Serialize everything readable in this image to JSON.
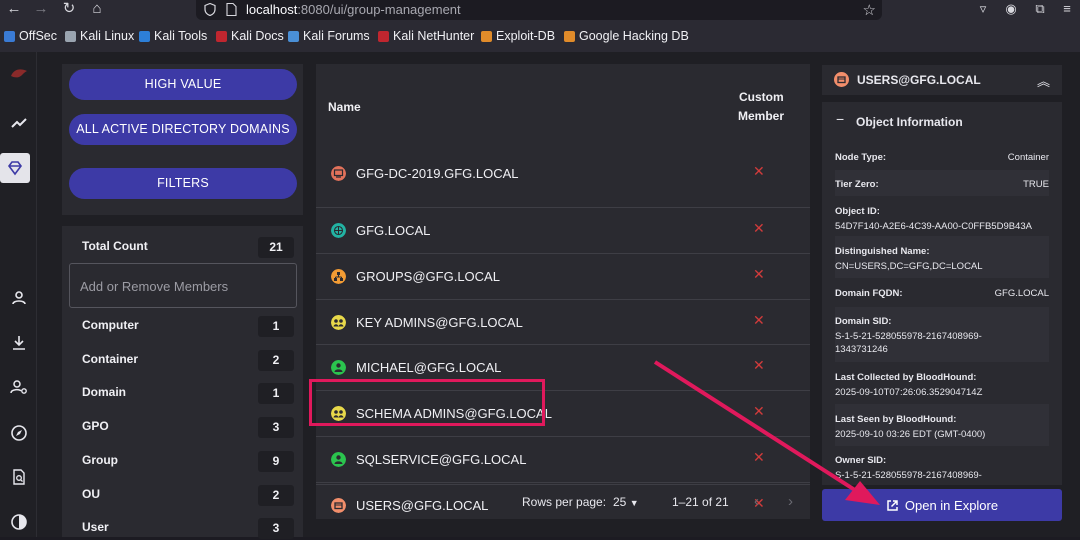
{
  "browser": {
    "url_host": "localhost",
    "url_path": ":8080/ui/group-management",
    "bookmarks": [
      {
        "label": "OffSec",
        "color": "#3a7bd5"
      },
      {
        "label": "Kali Linux",
        "color": "#9aa4b0"
      },
      {
        "label": "Kali Tools",
        "color": "#2d7fd8"
      },
      {
        "label": "Kali Docs",
        "color": "#c0262f"
      },
      {
        "label": "Kali Forums",
        "color": "#4a8fd6"
      },
      {
        "label": "Kali NetHunter",
        "color": "#c0262f"
      },
      {
        "label": "Exploit-DB",
        "color": "#e08b2a"
      },
      {
        "label": "Google Hacking DB",
        "color": "#e08b2a"
      }
    ]
  },
  "filters": {
    "high_value": "HIGH VALUE",
    "all_domains": "ALL ACTIVE DIRECTORY DOMAINS",
    "filters": "FILTERS"
  },
  "counts": {
    "total_label": "Total Count",
    "total": "21",
    "search_placeholder": "Add or Remove Members",
    "items": [
      {
        "label": "Computer",
        "count": "1"
      },
      {
        "label": "Container",
        "count": "2"
      },
      {
        "label": "Domain",
        "count": "1"
      },
      {
        "label": "GPO",
        "count": "3"
      },
      {
        "label": "Group",
        "count": "9"
      },
      {
        "label": "OU",
        "count": "2"
      },
      {
        "label": "User",
        "count": "3"
      }
    ]
  },
  "table": {
    "col_name": "Name",
    "col_custom_1": "Custom",
    "col_custom_2": "Member",
    "rows": [
      {
        "name": "GFG-DC-2019.GFG.LOCAL",
        "icon": "computer-icon",
        "color": "#e2725b"
      },
      {
        "name": "GFG.LOCAL",
        "icon": "globe-icon",
        "color": "#22b3a3"
      },
      {
        "name": "GROUPS@GFG.LOCAL",
        "icon": "tree-icon",
        "color": "#f39c34"
      },
      {
        "name": "KEY ADMINS@GFG.LOCAL",
        "icon": "group-icon",
        "color": "#e8d94a"
      },
      {
        "name": "MICHAEL@GFG.LOCAL",
        "icon": "user-icon",
        "color": "#2bc44e"
      },
      {
        "name": "SCHEMA ADMINS@GFG.LOCAL",
        "icon": "group-icon",
        "color": "#e8d94a"
      },
      {
        "name": "SQLSERVICE@GFG.LOCAL",
        "icon": "user-icon",
        "color": "#2bc44e"
      },
      {
        "name": "USERS@GFG.LOCAL",
        "icon": "box-icon",
        "color": "#f28e6b"
      }
    ],
    "remove_mark": "✕",
    "rows_per_page_label": "Rows per page:",
    "rows_per_page": "25",
    "range": "1–21 of 21"
  },
  "object": {
    "title": "USERS@GFG.LOCAL",
    "section": "Object Information",
    "node_type_k": "Node Type:",
    "node_type_v": "Container",
    "tier_zero_k": "Tier Zero:",
    "tier_zero_v": "TRUE",
    "object_id_k": "Object ID:",
    "object_id_v": "54D7F140-A2E6-4C39-AA00-C0FFB5D9B43A",
    "dn_k": "Distinguished Name:",
    "dn_v": "CN=USERS,DC=GFG,DC=LOCAL",
    "fqdn_k": "Domain FQDN:",
    "fqdn_v": "GFG.LOCAL",
    "sid_k": "Domain SID:",
    "sid_v1": "S-1-5-21-528055978-2167408969-",
    "sid_v2": "1343731246",
    "collected_k": "Last Collected by BloodHound:",
    "collected_v": "2025-09-10T07:26:06.352904714Z",
    "seen_k": "Last Seen by BloodHound:",
    "seen_v": "2025-09-10 03:26 EDT (GMT-0400)",
    "owner_k": "Owner SID:",
    "owner_v": "S-1-5-21-528055978-2167408969-",
    "open_btn": "Open in Explore"
  },
  "colors": {
    "accent": "#3d3aa6",
    "highlight": "#e0195c",
    "remove": "#d23b3b"
  }
}
